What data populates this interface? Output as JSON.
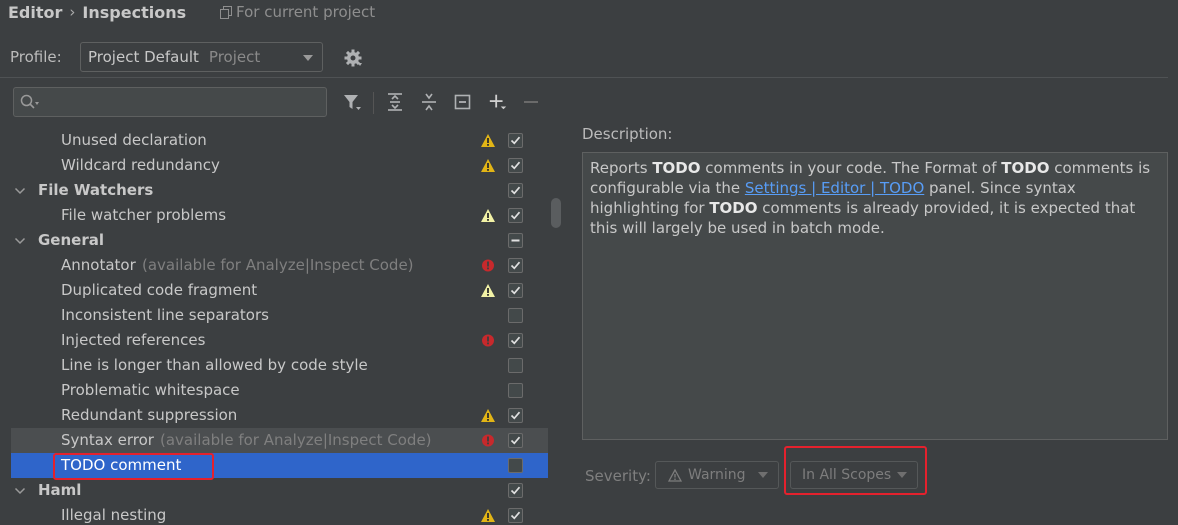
{
  "breadcrumb": {
    "items": [
      "Editor",
      "Inspections"
    ],
    "separator": "›",
    "scope_note": "For current project"
  },
  "profile": {
    "label": "Profile:",
    "value": "Project Default",
    "hint": "Project"
  },
  "search": {
    "value": "",
    "placeholder": ""
  },
  "tree": {
    "rows": [
      {
        "label": "Unused declaration",
        "hint": "",
        "group": false,
        "expanded": null,
        "severity": "warning",
        "checkbox": "checked",
        "state": "normal"
      },
      {
        "label": "Wildcard redundancy",
        "hint": "",
        "group": false,
        "expanded": null,
        "severity": "warning",
        "checkbox": "checked",
        "state": "normal"
      },
      {
        "label": "File Watchers",
        "hint": "",
        "group": true,
        "expanded": true,
        "severity": "none",
        "checkbox": "checked",
        "state": "normal"
      },
      {
        "label": "File watcher problems",
        "hint": "",
        "group": false,
        "expanded": null,
        "severity": "weak-warning",
        "checkbox": "checked",
        "state": "normal"
      },
      {
        "label": "General",
        "hint": "",
        "group": true,
        "expanded": true,
        "severity": "none",
        "checkbox": "indeterminate",
        "state": "normal"
      },
      {
        "label": "Annotator",
        "hint": "(available for Analyze|Inspect Code)",
        "group": false,
        "expanded": null,
        "severity": "error",
        "checkbox": "checked",
        "state": "normal"
      },
      {
        "label": "Duplicated code fragment",
        "hint": "",
        "group": false,
        "expanded": null,
        "severity": "weak-warning",
        "checkbox": "checked",
        "state": "normal"
      },
      {
        "label": "Inconsistent line separators",
        "hint": "",
        "group": false,
        "expanded": null,
        "severity": "none",
        "checkbox": "unchecked",
        "state": "normal"
      },
      {
        "label": "Injected references",
        "hint": "",
        "group": false,
        "expanded": null,
        "severity": "error",
        "checkbox": "checked",
        "state": "normal"
      },
      {
        "label": "Line is longer than allowed by code style",
        "hint": "",
        "group": false,
        "expanded": null,
        "severity": "none",
        "checkbox": "unchecked",
        "state": "normal"
      },
      {
        "label": "Problematic whitespace",
        "hint": "",
        "group": false,
        "expanded": null,
        "severity": "none",
        "checkbox": "unchecked",
        "state": "normal"
      },
      {
        "label": "Redundant suppression",
        "hint": "",
        "group": false,
        "expanded": null,
        "severity": "warning",
        "checkbox": "checked",
        "state": "normal"
      },
      {
        "label": "Syntax error",
        "hint": "(available for Analyze|Inspect Code)",
        "group": false,
        "expanded": null,
        "severity": "error",
        "checkbox": "checked",
        "state": "hover"
      },
      {
        "label": "TODO comment",
        "hint": "",
        "group": false,
        "expanded": null,
        "severity": "none",
        "checkbox": "unchecked",
        "state": "selected"
      },
      {
        "label": "Haml",
        "hint": "",
        "group": true,
        "expanded": true,
        "severity": "none",
        "checkbox": "checked",
        "state": "normal"
      },
      {
        "label": "Illegal nesting",
        "hint": "",
        "group": false,
        "expanded": null,
        "severity": "warning",
        "checkbox": "checked",
        "state": "normal"
      }
    ]
  },
  "description": {
    "title": "Description:",
    "t1": "Reports ",
    "b1": "TODO",
    "t2": " comments in your code. The Format of ",
    "b2": "TODO",
    "t3": " comments is configurable via the ",
    "link": "Settings | Editor | TODO",
    "t4": " panel. Since syntax highlighting for ",
    "b3": "TODO",
    "t5": " comments is already provided, it is expected that this will largely be used in batch mode."
  },
  "severity": {
    "label": "Severity:",
    "value": "Warning",
    "scope": "In All Scopes"
  },
  "colors": {
    "background": "#3c3f41",
    "selection": "#2f65ca",
    "warning": "#e2b516",
    "weak_warning": "#f2f2a6",
    "error": "#c7292c",
    "highlight": "#e5212d",
    "link": "#589df6"
  },
  "icons": {
    "copy": "copy-icon",
    "gear": "gear-icon",
    "search": "search-icon",
    "filter": "filter-icon",
    "expand_all": "expand-all-icon",
    "collapse_all": "collapse-all-icon",
    "reset": "reset-icon",
    "add": "add-icon",
    "remove": "remove-icon"
  }
}
